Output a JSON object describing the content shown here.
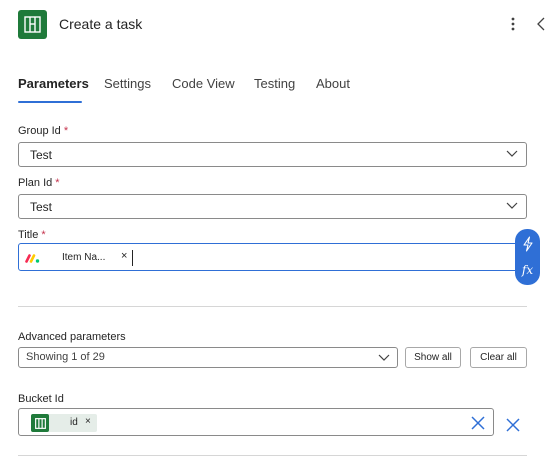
{
  "header": {
    "title": "Create a task",
    "icon": "planner-icon",
    "accent_color": "#1f7a3a"
  },
  "tabs": [
    {
      "label": "Parameters",
      "active": true
    },
    {
      "label": "Settings",
      "active": false
    },
    {
      "label": "Code View",
      "active": false
    },
    {
      "label": "Testing",
      "active": false
    },
    {
      "label": "About",
      "active": false
    }
  ],
  "fields": {
    "group_id": {
      "label": "Group Id",
      "required_mark": "*",
      "value": "Test"
    },
    "plan_id": {
      "label": "Plan Id",
      "required_mark": "*",
      "value": "Test"
    },
    "title": {
      "label": "Title",
      "required_mark": "*",
      "token_label": "Item Na...",
      "token_icon": "monday-icon",
      "token_remove": "×"
    }
  },
  "side_actions": {
    "dynamic_content_icon": "lightning-icon",
    "expression_label": "fx"
  },
  "advanced": {
    "label": "Advanced parameters",
    "select_value": "Showing 1 of 29",
    "show_all_label": "Show all",
    "clear_all_label": "Clear all"
  },
  "bucket": {
    "label": "Bucket Id",
    "token_label": "id",
    "token_icon": "planner-icon",
    "token_remove": "×"
  },
  "colors": {
    "accent_blue": "#2f6fd6",
    "required_red": "#c4314b",
    "planner_green": "#1f7a3a"
  }
}
